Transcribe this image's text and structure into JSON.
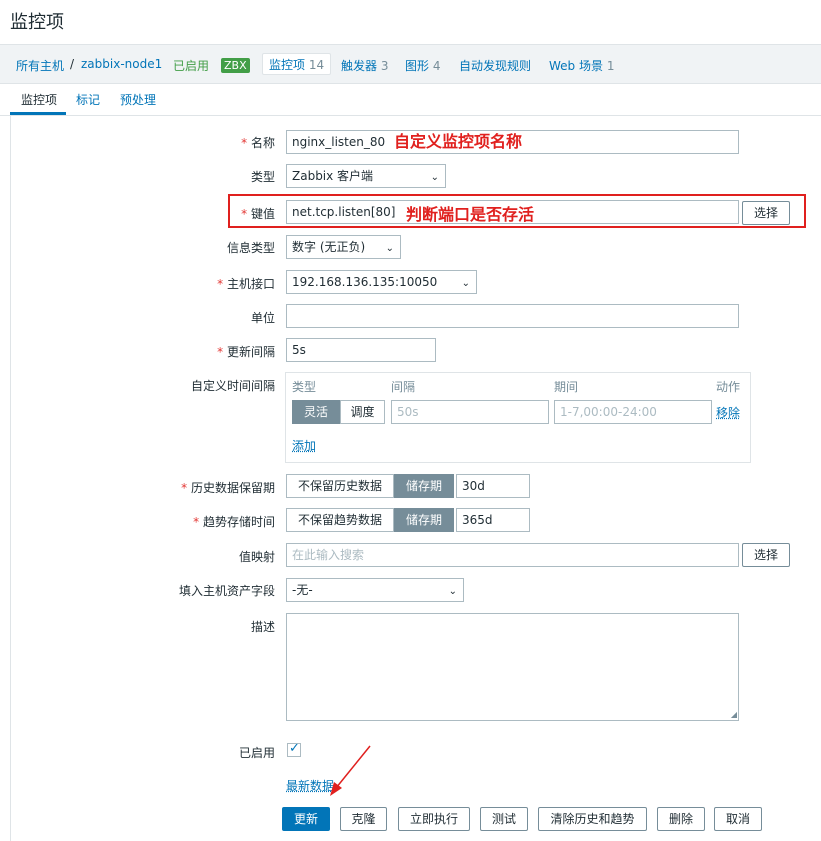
{
  "page": {
    "title": "监控项"
  },
  "breadcrumb": {
    "all_hosts": "所有主机",
    "separator": "/",
    "host": "zabbix-node1",
    "enabled": "已启用",
    "zbx": "ZBX",
    "items_label": "监控项",
    "items_count": "14",
    "triggers_label": "触发器",
    "triggers_count": "3",
    "graphs_label": "图形",
    "graphs_count": "4",
    "discovery": "自动发现规则",
    "web_label": "Web 场景",
    "web_count": "1"
  },
  "tabs": [
    "监控项",
    "标记",
    "预处理"
  ],
  "form": {
    "name": {
      "label": "名称",
      "value": "nginx_listen_80"
    },
    "type": {
      "label": "类型",
      "value": "Zabbix 客户端"
    },
    "key": {
      "label": "键值",
      "value": "net.tcp.listen[80]",
      "select": "选择"
    },
    "info_type": {
      "label": "信息类型",
      "value": "数字 (无正负)"
    },
    "interface": {
      "label": "主机接口",
      "value": "192.168.136.135:10050"
    },
    "units": {
      "label": "单位",
      "value": ""
    },
    "interval": {
      "label": "更新间隔",
      "value": "5s"
    },
    "custom_intervals": {
      "label": "自定义时间间隔",
      "col_type": "类型",
      "col_interval": "间隔",
      "col_period": "期间",
      "col_action": "动作",
      "flexible": "灵活",
      "scheduling": "调度",
      "interval_placeholder": "50s",
      "period_placeholder": "1-7,00:00-24:00",
      "remove": "移除",
      "add": "添加"
    },
    "history": {
      "label": "历史数据保留期",
      "off": "不保留历史数据",
      "on": "储存期",
      "value": "30d"
    },
    "trends": {
      "label": "趋势存储时间",
      "off": "不保留趋势数据",
      "on": "储存期",
      "value": "365d"
    },
    "valuemap": {
      "label": "值映射",
      "placeholder": "在此输入搜索",
      "select": "选择"
    },
    "inventory": {
      "label": "填入主机资产字段",
      "value": "-无-"
    },
    "description": {
      "label": "描述"
    },
    "enabled": {
      "label": "已启用",
      "checked": true
    },
    "latest_data": "最新数据"
  },
  "buttons": {
    "update": "更新",
    "clone": "克隆",
    "execute": "立即执行",
    "test": "测试",
    "clear": "清除历史和趋势",
    "delete": "删除",
    "cancel": "取消"
  },
  "annotations": {
    "name_note": "自定义监控项名称",
    "key_note": "判断端口是否存活"
  },
  "colors": {
    "accent": "#0275b8",
    "required": "#e33734",
    "annotation": "#e0201e",
    "enabled": "#429e47"
  },
  "icons": {
    "dropdown": "chevron-down-icon",
    "checkbox": "check-icon",
    "arrow": "red-arrow-icon"
  }
}
